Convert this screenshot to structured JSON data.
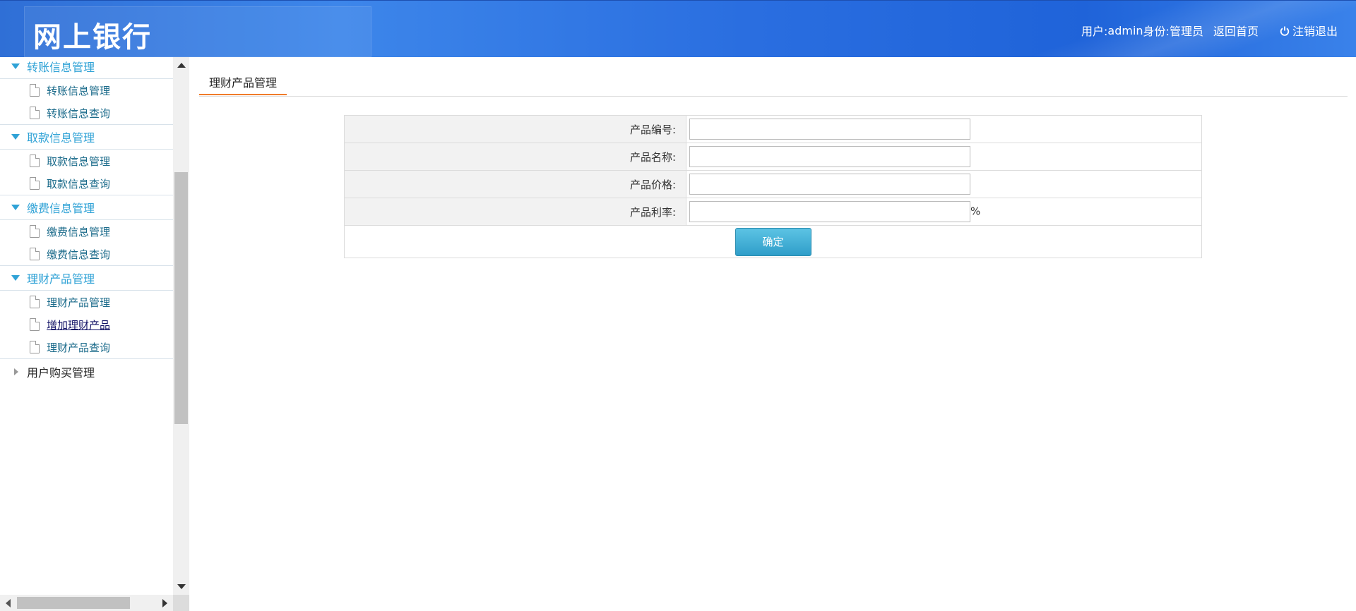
{
  "header": {
    "logo": "网上银行",
    "user_label": "用户:",
    "username": "admin",
    "role_label": "身份:",
    "role": "管理员",
    "home_link": "返回首页",
    "logout": "注销退出"
  },
  "sidebar": {
    "groups": [
      {
        "title": "转账信息管理",
        "items": [
          "转账信息管理",
          "转账信息查询"
        ]
      },
      {
        "title": "取款信息管理",
        "items": [
          "取款信息管理",
          "取款信息查询"
        ]
      },
      {
        "title": "缴费信息管理",
        "items": [
          "缴费信息管理",
          "缴费信息查询"
        ]
      },
      {
        "title": "理财产品管理",
        "items": [
          "理财产品管理",
          "增加理财产品",
          "理财产品查询"
        ]
      }
    ],
    "collapsed_group": "用户购买管理"
  },
  "main": {
    "tab": "理财产品管理",
    "form": {
      "fields": [
        {
          "label": "产品编号:",
          "value": ""
        },
        {
          "label": "产品名称:",
          "value": ""
        },
        {
          "label": "产品价格:",
          "value": ""
        },
        {
          "label": "产品利率:",
          "value": "",
          "suffix": "%"
        }
      ],
      "submit": "确定"
    }
  },
  "colors": {
    "header_blue": "#2a6ee0",
    "menu_accent": "#2fa2d6",
    "tab_underline": "#f07b2a",
    "button": "#3aaad3"
  }
}
